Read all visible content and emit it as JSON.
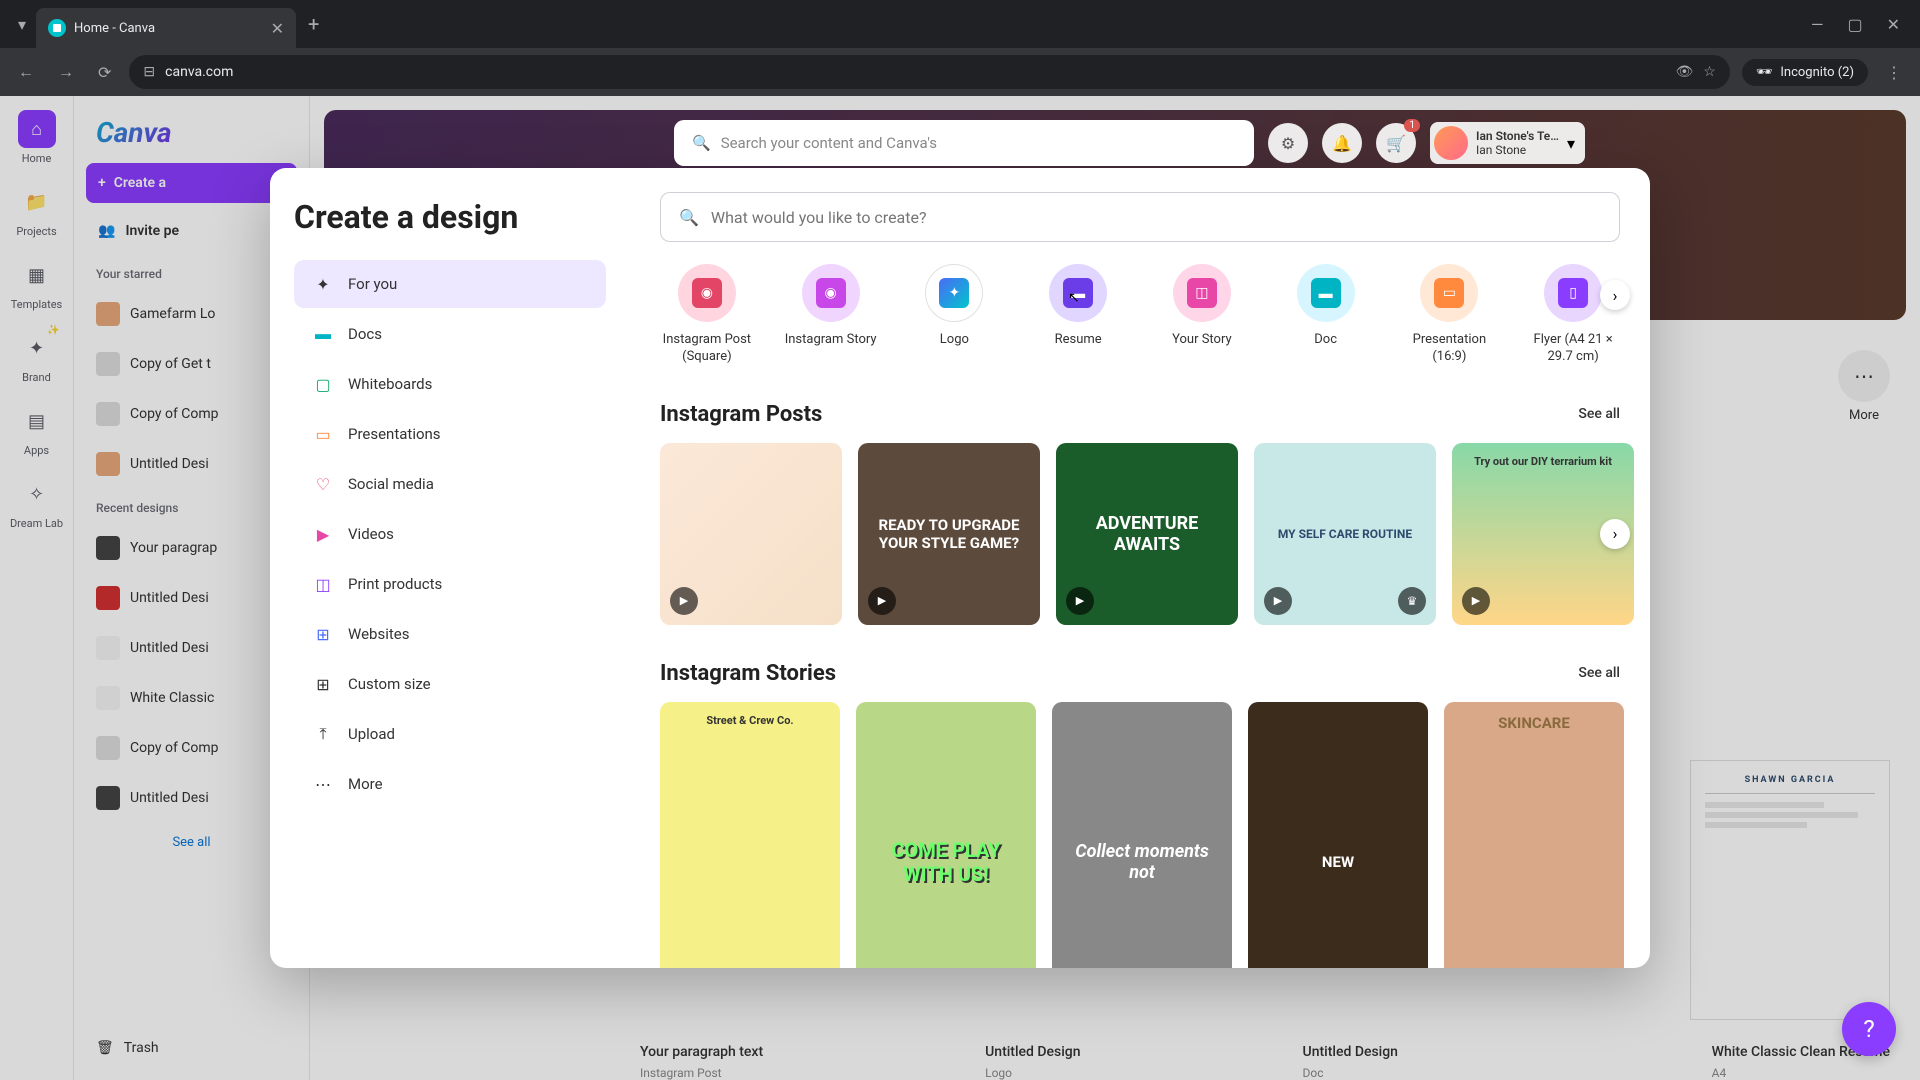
{
  "browser": {
    "tab_title": "Home - Canva",
    "url": "canva.com",
    "incognito_label": "Incognito (2)"
  },
  "left_rail": {
    "items": [
      {
        "label": "Home",
        "icon": "🏠"
      },
      {
        "label": "Projects",
        "icon": "📁"
      },
      {
        "label": "Templates",
        "icon": "▦"
      },
      {
        "label": "Brand",
        "icon": "✦"
      },
      {
        "label": "Apps",
        "icon": "▤"
      },
      {
        "label": "Dream Lab",
        "icon": "✧"
      }
    ]
  },
  "sidebar": {
    "logo": "Canva",
    "create_label": "Create a",
    "invite_label": "Invite pe",
    "starred_label": "Your starred",
    "starred_items": [
      "Gamefarm Lo",
      "Copy of Get t",
      "Copy of Comp",
      "Untitled Desi"
    ],
    "recent_label": "Recent designs",
    "recent_items": [
      "Your paragrap",
      "Untitled Desi",
      "Untitled Desi",
      "White Classic",
      "Copy of Comp",
      "Untitled Desi"
    ],
    "see_all": "See all",
    "trash": "Trash"
  },
  "top_bar": {
    "search_placeholder": "Search your content and Canva's",
    "cart_count": "1",
    "user_team": "Ian Stone's Te…",
    "user_name": "Ian Stone"
  },
  "bg_chips": {
    "more": "More"
  },
  "bg_recent": [
    {
      "title": "Your paragraph text",
      "sub": "Instagram Post"
    },
    {
      "title": "Untitled Design",
      "sub": "Logo"
    },
    {
      "title": "Untitled Design",
      "sub": "Doc"
    },
    {
      "title": "White Classic Clean Resume",
      "sub": "A4"
    }
  ],
  "resume_name": "SHAWN GARCIA",
  "modal": {
    "title": "Create a design",
    "close_label": "✕",
    "search_placeholder": "What would you like to create?",
    "categories": [
      {
        "label": "For you",
        "icon": "✦",
        "active": true
      },
      {
        "label": "Docs",
        "icon": "📄"
      },
      {
        "label": "Whiteboards",
        "icon": "🟩"
      },
      {
        "label": "Presentations",
        "icon": "🟧"
      },
      {
        "label": "Social media",
        "icon": "🟪"
      },
      {
        "label": "Videos",
        "icon": "🟥"
      },
      {
        "label": "Print products",
        "icon": "🟪"
      },
      {
        "label": "Websites",
        "icon": "🟦"
      },
      {
        "label": "Custom size",
        "icon": "⊞"
      },
      {
        "label": "Upload",
        "icon": "⤒"
      },
      {
        "label": "More",
        "icon": "⋯"
      }
    ],
    "types": [
      {
        "label": "Instagram Post (Square)"
      },
      {
        "label": "Instagram Story"
      },
      {
        "label": "Logo"
      },
      {
        "label": "Resume"
      },
      {
        "label": "Your Story"
      },
      {
        "label": "Doc"
      },
      {
        "label": "Presentation (16:9)"
      },
      {
        "label": "Flyer (A4 21 × 29.7 cm)"
      }
    ],
    "section_posts": "Instagram Posts",
    "section_stories": "Instagram Stories",
    "see_all": "See all",
    "post_thumbs": [
      {
        "text": ""
      },
      {
        "text": "READY TO UPGRADE YOUR STYLE GAME?"
      },
      {
        "text": "ADVENTURE AWAITS"
      },
      {
        "text": "MY SELF CARE ROUTINE"
      },
      {
        "text": "Try out our DIY terrarium kit"
      }
    ],
    "story_thumbs": [
      {
        "text": "Street & Crew Co."
      },
      {
        "text": "COME PLAY WITH US!"
      },
      {
        "text": "Collect moments not"
      },
      {
        "text": "NEW"
      },
      {
        "text": "SKINCARE"
      }
    ]
  },
  "help_icon": "?"
}
